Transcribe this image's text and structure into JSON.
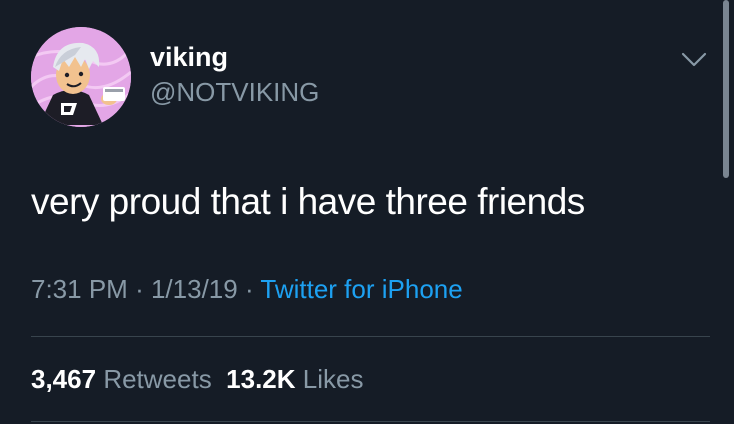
{
  "tweet": {
    "author": {
      "display_name": "viking",
      "handle": "@NOTVIKING"
    },
    "text": "very proud that i have three friends",
    "time": "7:31 PM",
    "separator": "·",
    "date": "1/13/19",
    "source": "Twitter for iPhone",
    "stats": {
      "retweets_count": "3,467",
      "retweets_label": "Retweets",
      "likes_count": "13.2K",
      "likes_label": "Likes"
    }
  },
  "icons": {
    "menu": "chevron-down-icon",
    "avatar": "avatar"
  },
  "colors": {
    "background": "#151c26",
    "primary_text": "#ffffff",
    "secondary_text": "#8899a6",
    "link": "#1da1f2",
    "divider": "#38444d"
  }
}
